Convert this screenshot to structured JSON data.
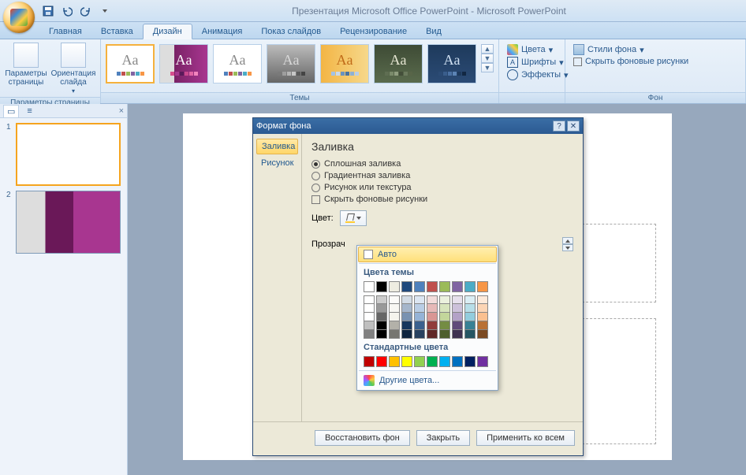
{
  "title": "Презентация Microsoft Office PowerPoint - Microsoft PowerPoint",
  "tabs": [
    "Главная",
    "Вставка",
    "Дизайн",
    "Анимация",
    "Показ слайдов",
    "Рецензирование",
    "Вид"
  ],
  "active_tab": 2,
  "ribbon": {
    "page_group": {
      "label": "Параметры страницы",
      "btn_page": "Параметры страницы",
      "btn_orient": "Ориентация слайда"
    },
    "themes_label": "Темы",
    "colors": "Цвета",
    "fonts": "Шрифты",
    "effects": "Эффекты",
    "bg_styles": "Стили фона",
    "hide_bg": "Скрыть фоновые рисунки",
    "bg_label": "Фон"
  },
  "slides": [
    1,
    2
  ],
  "dialog": {
    "title": "Формат фона",
    "nav": {
      "fill": "Заливка",
      "picture": "Рисунок"
    },
    "heading": "Заливка",
    "opts": {
      "solid": "Сплошная заливка",
      "gradient": "Градиентная заливка",
      "texture": "Рисунок или текстура",
      "hide": "Скрыть фоновые рисунки"
    },
    "color_label": "Цвет:",
    "trans_label": "Прозрач",
    "buttons": {
      "reset": "Восстановить фон",
      "close": "Закрыть",
      "apply_all": "Применить ко всем"
    }
  },
  "popup": {
    "auto": "Авто",
    "theme_colors": "Цвета темы",
    "standard": "Стандартные цвета",
    "more": "Другие цвета...",
    "theme_row": [
      "#ffffff",
      "#000000",
      "#eeece1",
      "#1f497d",
      "#4f81bd",
      "#c0504d",
      "#9bbb59",
      "#8064a2",
      "#4bacc6",
      "#f79646"
    ],
    "standard_row": [
      "#c00000",
      "#ff0000",
      "#ffc000",
      "#ffff00",
      "#92d050",
      "#00b050",
      "#00b0f0",
      "#0070c0",
      "#002060",
      "#7030a0"
    ]
  },
  "theme_palettes": [
    [
      "#4f81bd",
      "#c0504d",
      "#9bbb59",
      "#8064a2",
      "#4bacc6",
      "#f79646"
    ],
    [
      "#d64f8e",
      "#a5398e",
      "#5a1a5a",
      "#c9488e",
      "#e164a5",
      "#f284bd"
    ],
    [
      "#4f81bd",
      "#c0504d",
      "#9bbb59",
      "#8064a2",
      "#4bacc6",
      "#f79646"
    ],
    [
      "#7a7a7a",
      "#9e9e9e",
      "#b5b5b5",
      "#c7c7c7",
      "#5c5c5c",
      "#444444"
    ],
    [
      "#a4c2e3",
      "#c8d9ec",
      "#6a93c0",
      "#4a73a0",
      "#8eb0d3",
      "#b9cee6"
    ],
    [
      "#5f6e52",
      "#7a8a6a",
      "#8f9d7f",
      "#444f3a",
      "#6b7a5d",
      "#586548"
    ],
    [
      "#2b4b75",
      "#3a5e8c",
      "#4a71a3",
      "#5c84b5",
      "#1e3a5c",
      "#122843"
    ]
  ]
}
